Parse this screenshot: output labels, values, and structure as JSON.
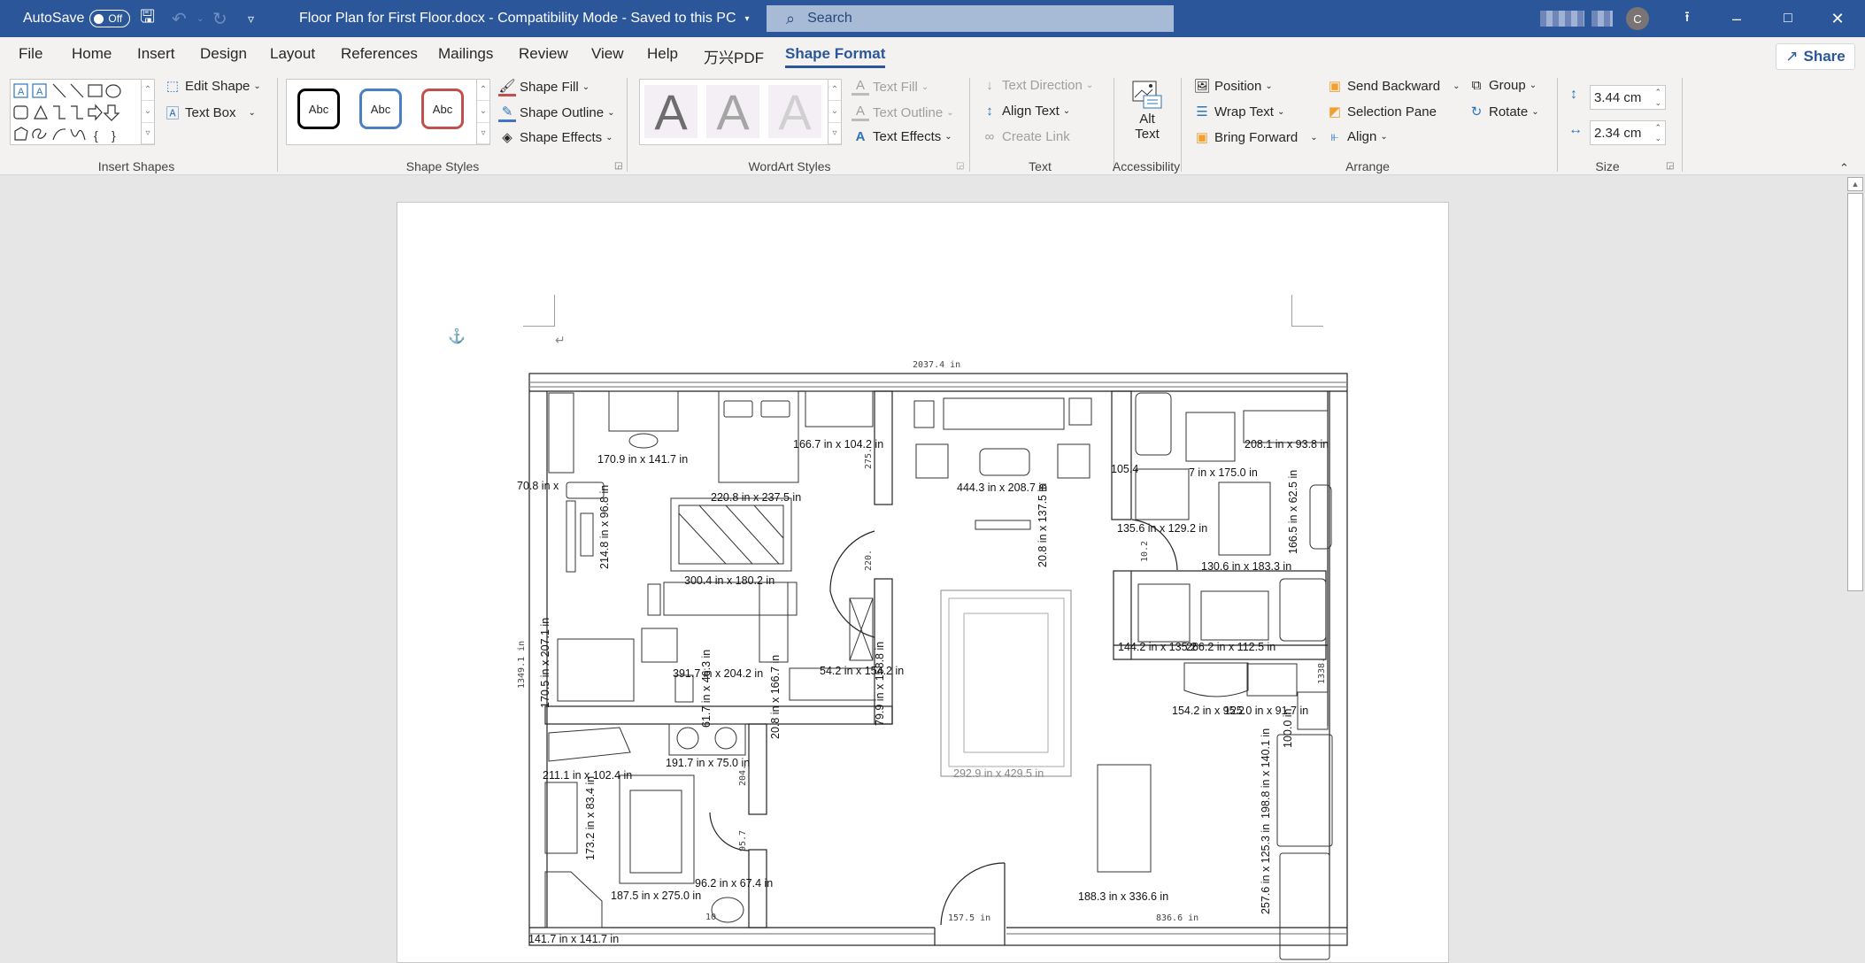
{
  "titlebar": {
    "autosave_label": "AutoSave",
    "autosave_state": "Off",
    "doc_title": "Floor Plan for First Floor.docx  -  Compatibility Mode  -  Saved to this PC",
    "search_placeholder": "Search",
    "avatar_initial": "C"
  },
  "menu_tabs": [
    "File",
    "Home",
    "Insert",
    "Design",
    "Layout",
    "References",
    "Mailings",
    "Review",
    "View",
    "Help",
    "万兴PDF",
    "Shape Format"
  ],
  "active_tab": "Shape Format",
  "share_label": "Share",
  "ribbon": {
    "insert_shapes": {
      "label": "Insert Shapes",
      "edit_shape": "Edit Shape",
      "text_box": "Text Box"
    },
    "shape_styles": {
      "label": "Shape Styles",
      "style_samples": [
        "Abc",
        "Abc",
        "Abc"
      ],
      "shape_fill": "Shape Fill",
      "shape_outline": "Shape Outline",
      "shape_effects": "Shape Effects"
    },
    "wordart_styles": {
      "label": "WordArt Styles",
      "samples": [
        "A",
        "A",
        "A"
      ],
      "text_fill": "Text Fill",
      "text_outline": "Text Outline",
      "text_effects": "Text Effects"
    },
    "text": {
      "label": "Text",
      "text_direction": "Text Direction",
      "align_text": "Align Text",
      "create_link": "Create Link"
    },
    "accessibility": {
      "label": "Accessibility",
      "alt_text_line1": "Alt",
      "alt_text_line2": "Text"
    },
    "arrange": {
      "label": "Arrange",
      "position": "Position",
      "wrap_text": "Wrap Text",
      "bring_forward": "Bring Forward",
      "send_backward": "Send Backward",
      "selection_pane": "Selection Pane",
      "align": "Align",
      "group": "Group",
      "rotate": "Rotate"
    },
    "size": {
      "label": "Size",
      "height": "3.44 cm",
      "width": "2.34 cm"
    }
  },
  "floor_plan": {
    "overall_width": "2037.4 in",
    "overall_height": "1349.1 in",
    "right_height": "1338.",
    "bottom_left_door": "157.5 in",
    "bottom_right_wall": "836.6 in",
    "labels": [
      "170.9 in x 141.7 in",
      "220.8 in x 237.5 in",
      "166.7 in x 104.2 in",
      "70.8 in x",
      "300.4 in x 180.2 in",
      "391.7 in x 204.2 in",
      "54.2 in x 154.2 in",
      "191.7 in x 75.0 in",
      "211.1 in x 102.4 in",
      "187.5 in x 275.0 in",
      "96.2 in x 67.4 in",
      "141.7 in x 141.7 in",
      "444.3 in x 208.7 in",
      "292.9 in x 429.5 in",
      "188.3 in x 336.6 in",
      "208.1 in x 93.8 in",
      "105.4",
      "7 in x 175.0 in",
      "135.6 in x 129.2 in",
      "130.6 in x 183.3 in",
      "144.2 in x 135.2",
      "266.2 in x 112.5 in",
      "154.2 in x 95.2",
      "125.0 in x 91.7 in"
    ],
    "vertical_labels": [
      "214.8 in x 96.8 in",
      "170.5 in x 207.1 in",
      "61.7 in x 46.3 in",
      "20.8 in x 166.7 in",
      "79.9 in x 158.8 in",
      "173.2 in x 83.4 in",
      "20.8 in x 137.5 in",
      "166.5 in x 62.5 in",
      "198.8 in x 140.1 in",
      "257.6 in x 125.3 in",
      "100.0 in"
    ],
    "dim_marks": [
      "275.",
      "220.",
      "204.",
      "95.7",
      "10.2",
      "10"
    ]
  }
}
